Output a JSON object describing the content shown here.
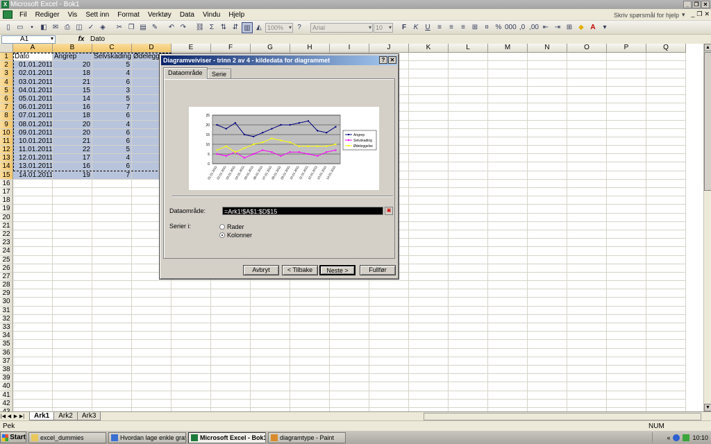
{
  "window": {
    "title": "Microsoft Excel - Bok1"
  },
  "menu": {
    "items": [
      "Fil",
      "Rediger",
      "Vis",
      "Sett inn",
      "Format",
      "Verktøy",
      "Data",
      "Vindu",
      "Hjelp"
    ],
    "help_placeholder": "Skriv spørsmål for hjelp"
  },
  "toolbar": {
    "zoom": "100%",
    "font": "Arial",
    "size": "10"
  },
  "formula": {
    "namebox": "A1",
    "fx_label": "fx",
    "content": "Dato"
  },
  "sheet": {
    "columns": [
      "A",
      "B",
      "C",
      "D",
      "E",
      "F",
      "G",
      "H",
      "I",
      "J",
      "K",
      "L",
      "M",
      "N",
      "O",
      "P",
      "Q"
    ],
    "row_count": 43,
    "header_row": [
      "Dato",
      "Angrep",
      "Selvskading",
      "Ødeleggelse"
    ],
    "rows": [
      [
        "01.01.2011",
        "20",
        "5"
      ],
      [
        "02.01.2011",
        "18",
        "4"
      ],
      [
        "03.01.2011",
        "21",
        "6"
      ],
      [
        "04.01.2011",
        "15",
        "3"
      ],
      [
        "05.01.2011",
        "14",
        "5"
      ],
      [
        "06.01.2011",
        "16",
        "7"
      ],
      [
        "07.01.2011",
        "18",
        "6"
      ],
      [
        "08.01.2011",
        "20",
        "4"
      ],
      [
        "09.01.2011",
        "20",
        "6"
      ],
      [
        "10.01.2011",
        "21",
        "6"
      ],
      [
        "11.01.2011",
        "22",
        "5"
      ],
      [
        "12.01.2011",
        "17",
        "4"
      ],
      [
        "13.01.2011",
        "16",
        "6"
      ],
      [
        "14.01.2011",
        "19",
        "7"
      ]
    ]
  },
  "tabs": [
    "Ark1",
    "Ark2",
    "Ark3"
  ],
  "status": {
    "left": "Pek",
    "num": "NUM"
  },
  "taskbar": {
    "start": "Start",
    "items": [
      "excel_dummies",
      "Hvordan lage enkle graf...",
      "Microsoft Excel - Bok1",
      "diagramtype - Paint"
    ],
    "clock": "10:10"
  },
  "dialog": {
    "title": "Diagramveiviser - trinn 2 av 4 - kildedata for diagrammet",
    "tabs": [
      "Dataområde",
      "Serie"
    ],
    "range_label": "Dataområde:",
    "range_value": "=Ark1!$A$1:$D$15",
    "series_label": "Serier i:",
    "radio_rows": "Rader",
    "radio_columns": "Kolonner",
    "buttons": {
      "cancel": "Avbryt",
      "back": "< Tilbake",
      "next": "Neste >",
      "finish": "Fullfør"
    }
  },
  "chart_data": {
    "type": "line",
    "categories": [
      "01.01.2011",
      "02.01.2011",
      "03.01.2011",
      "04.01.2011",
      "05.01.2011",
      "06.01.2011",
      "07.01.2011",
      "08.01.2011",
      "09.01.2011",
      "10.01.2011",
      "11.01.2011",
      "12.01.2011",
      "13.01.2011",
      "14.01.2011"
    ],
    "series": [
      {
        "name": "Angrep",
        "color": "#000080",
        "values": [
          20,
          18,
          21,
          15,
          14,
          16,
          18,
          20,
          20,
          21,
          22,
          17,
          16,
          19
        ]
      },
      {
        "name": "Selvskading",
        "color": "#ff00ff",
        "values": [
          5,
          4,
          6,
          3,
          5,
          7,
          6,
          4,
          6,
          6,
          5,
          4,
          6,
          7
        ]
      },
      {
        "name": "Ødeleggelse",
        "color": "#ffff00",
        "values": [
          7,
          9,
          6,
          8,
          10,
          11,
          13,
          12,
          11,
          9,
          9,
          9,
          9,
          10
        ]
      }
    ],
    "ylim": [
      0,
      25
    ],
    "yticks": [
      0,
      5,
      10,
      15,
      20,
      25
    ],
    "plot_background": "#c0c0c0",
    "grid": true,
    "legend": "right"
  }
}
